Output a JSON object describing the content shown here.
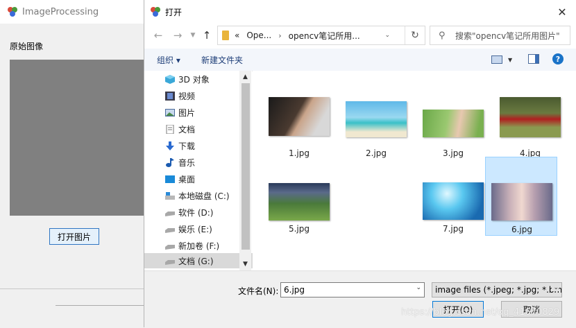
{
  "background_window": {
    "title": "ImageProcessing",
    "group_label": "原始图像",
    "open_image_button": "打开图片"
  },
  "dialog": {
    "title": "打开",
    "close_symbol": "✕",
    "breadcrumbs": [
      "«",
      "Ope...",
      "opencv笔记所用..."
    ],
    "search_placeholder": "搜索\"opencv笔记所用图片\"",
    "toolbar": {
      "organize": "组织 ▾",
      "new_folder": "新建文件夹",
      "help": "?"
    },
    "sidebar": {
      "items": [
        {
          "label": "3D 对象",
          "icon": "3d-objects-icon"
        },
        {
          "label": "视频",
          "icon": "video-icon"
        },
        {
          "label": "图片",
          "icon": "pictures-icon"
        },
        {
          "label": "文档",
          "icon": "documents-icon"
        },
        {
          "label": "下载",
          "icon": "download-icon"
        },
        {
          "label": "音乐",
          "icon": "music-icon"
        },
        {
          "label": "桌面",
          "icon": "desktop-icon"
        },
        {
          "label": "本地磁盘 (C:)",
          "icon": "drive-icon"
        },
        {
          "label": "软件 (D:)",
          "icon": "drive-icon"
        },
        {
          "label": "娱乐 (E:)",
          "icon": "drive-icon"
        },
        {
          "label": "新加卷 (F:)",
          "icon": "drive-icon"
        },
        {
          "label": "文档 (G:)",
          "icon": "drive-icon",
          "selected": true
        }
      ]
    },
    "files": [
      {
        "name": "1.jpg"
      },
      {
        "name": "2.jpg"
      },
      {
        "name": "3.jpg"
      },
      {
        "name": "4.jpg"
      },
      {
        "name": "5.jpg"
      },
      {
        "name": "6.jpg",
        "selected": true
      },
      {
        "name": "7.jpg"
      }
    ],
    "filename_label": "文件名(N):",
    "filename_value": "6.jpg",
    "file_type_filter": "image files (*.jpeg; *.jpg; *.bmp",
    "open_button": "打开(O)",
    "cancel_button": "取消",
    "watermark": "https://blog.csdn.net/qq_41670829"
  },
  "colors": {
    "accent": "#0078d7",
    "selection": "#cce8ff",
    "toolbar_text": "#1e3e78"
  }
}
